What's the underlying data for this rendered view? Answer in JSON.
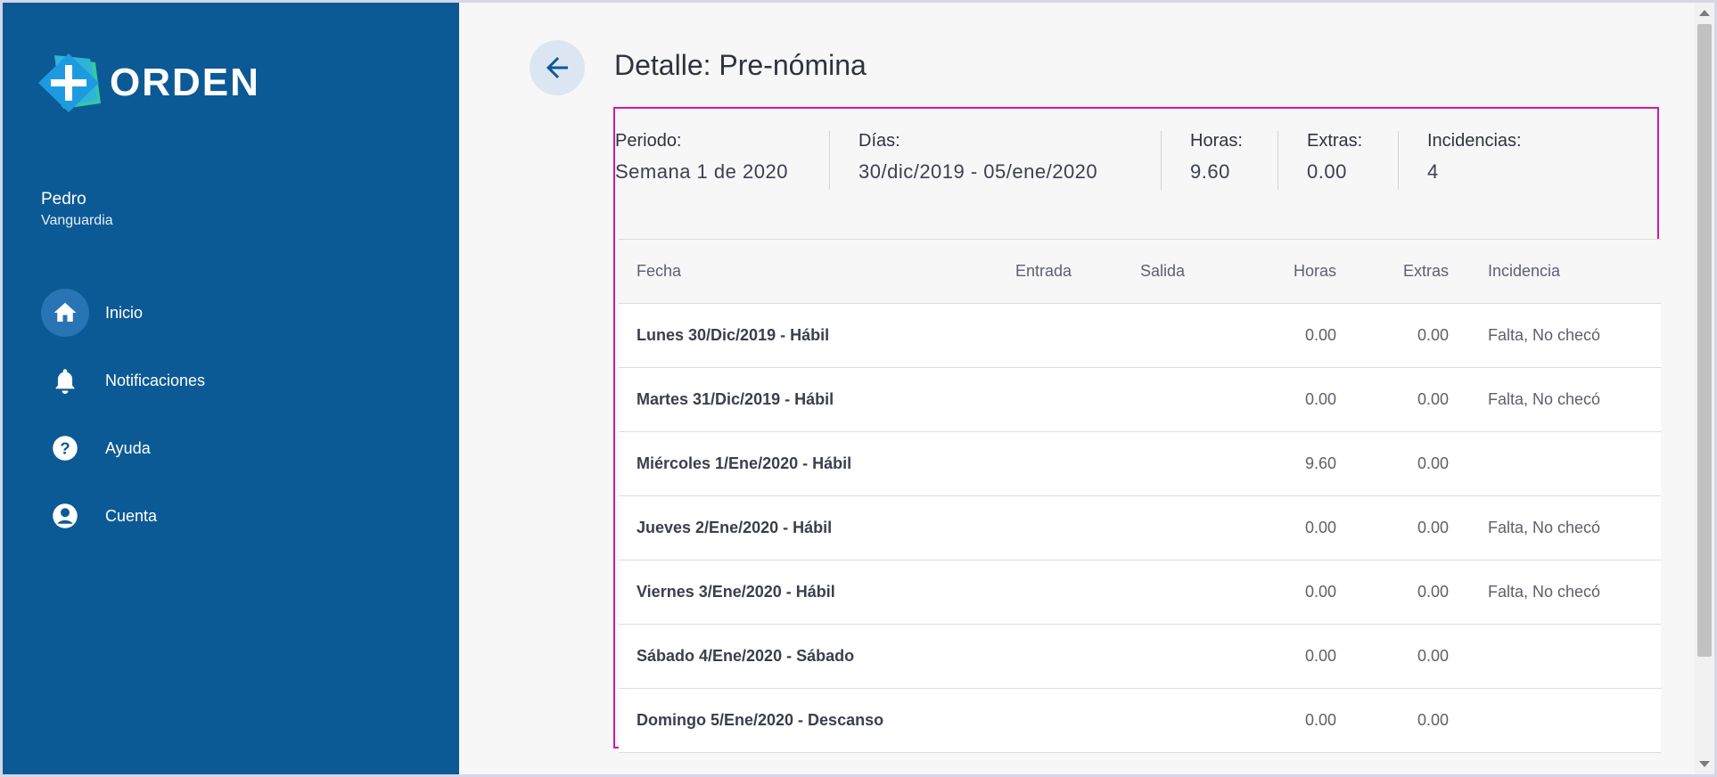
{
  "brand": {
    "name": "ORDEN"
  },
  "user": {
    "first_name": "Pedro",
    "last_name": "Vanguardia"
  },
  "nav": [
    {
      "label": "Inicio",
      "icon": "home-icon",
      "active": true
    },
    {
      "label": "Notificaciones",
      "icon": "bell-icon",
      "active": false
    },
    {
      "label": "Ayuda",
      "icon": "help-icon",
      "active": false
    },
    {
      "label": "Cuenta",
      "icon": "account-icon",
      "active": false
    }
  ],
  "page": {
    "title": "Detalle: Pre-nómina"
  },
  "summary": {
    "periodo": {
      "label": "Periodo:",
      "value": "Semana 1 de 2020"
    },
    "dias": {
      "label": "Días:",
      "value": "30/dic/2019 - 05/ene/2020"
    },
    "horas": {
      "label": "Horas:",
      "value": "9.60"
    },
    "extras": {
      "label": "Extras:",
      "value": "0.00"
    },
    "incidencias": {
      "label": "Incidencias:",
      "value": "4"
    }
  },
  "table": {
    "headers": {
      "fecha": "Fecha",
      "entrada": "Entrada",
      "salida": "Salida",
      "horas": "Horas",
      "extras": "Extras",
      "incidencia": "Incidencia"
    },
    "rows": [
      {
        "fecha": "Lunes 30/Dic/2019 - Hábil",
        "entrada": "",
        "salida": "",
        "horas": "0.00",
        "extras": "0.00",
        "incidencia": "Falta, No checó"
      },
      {
        "fecha": "Martes 31/Dic/2019 - Hábil",
        "entrada": "",
        "salida": "",
        "horas": "0.00",
        "extras": "0.00",
        "incidencia": "Falta, No checó"
      },
      {
        "fecha": "Miércoles 1/Ene/2020 - Hábil",
        "entrada": "",
        "salida": "",
        "horas": "9.60",
        "extras": "0.00",
        "incidencia": ""
      },
      {
        "fecha": "Jueves 2/Ene/2020 - Hábil",
        "entrada": "",
        "salida": "",
        "horas": "0.00",
        "extras": "0.00",
        "incidencia": "Falta, No checó"
      },
      {
        "fecha": "Viernes 3/Ene/2020 - Hábil",
        "entrada": "",
        "salida": "",
        "horas": "0.00",
        "extras": "0.00",
        "incidencia": "Falta, No checó"
      },
      {
        "fecha": "Sábado 4/Ene/2020 - Sábado",
        "entrada": "",
        "salida": "",
        "horas": "0.00",
        "extras": "0.00",
        "incidencia": ""
      },
      {
        "fecha": "Domingo 5/Ene/2020 - Descanso",
        "entrada": "",
        "salida": "",
        "horas": "0.00",
        "extras": "0.00",
        "incidencia": ""
      }
    ]
  },
  "colors": {
    "sidebar": "#0c5a95",
    "active_nav": "#2874b4",
    "panel_border": "#d01aa0",
    "back_button": "#dbe6f2"
  }
}
